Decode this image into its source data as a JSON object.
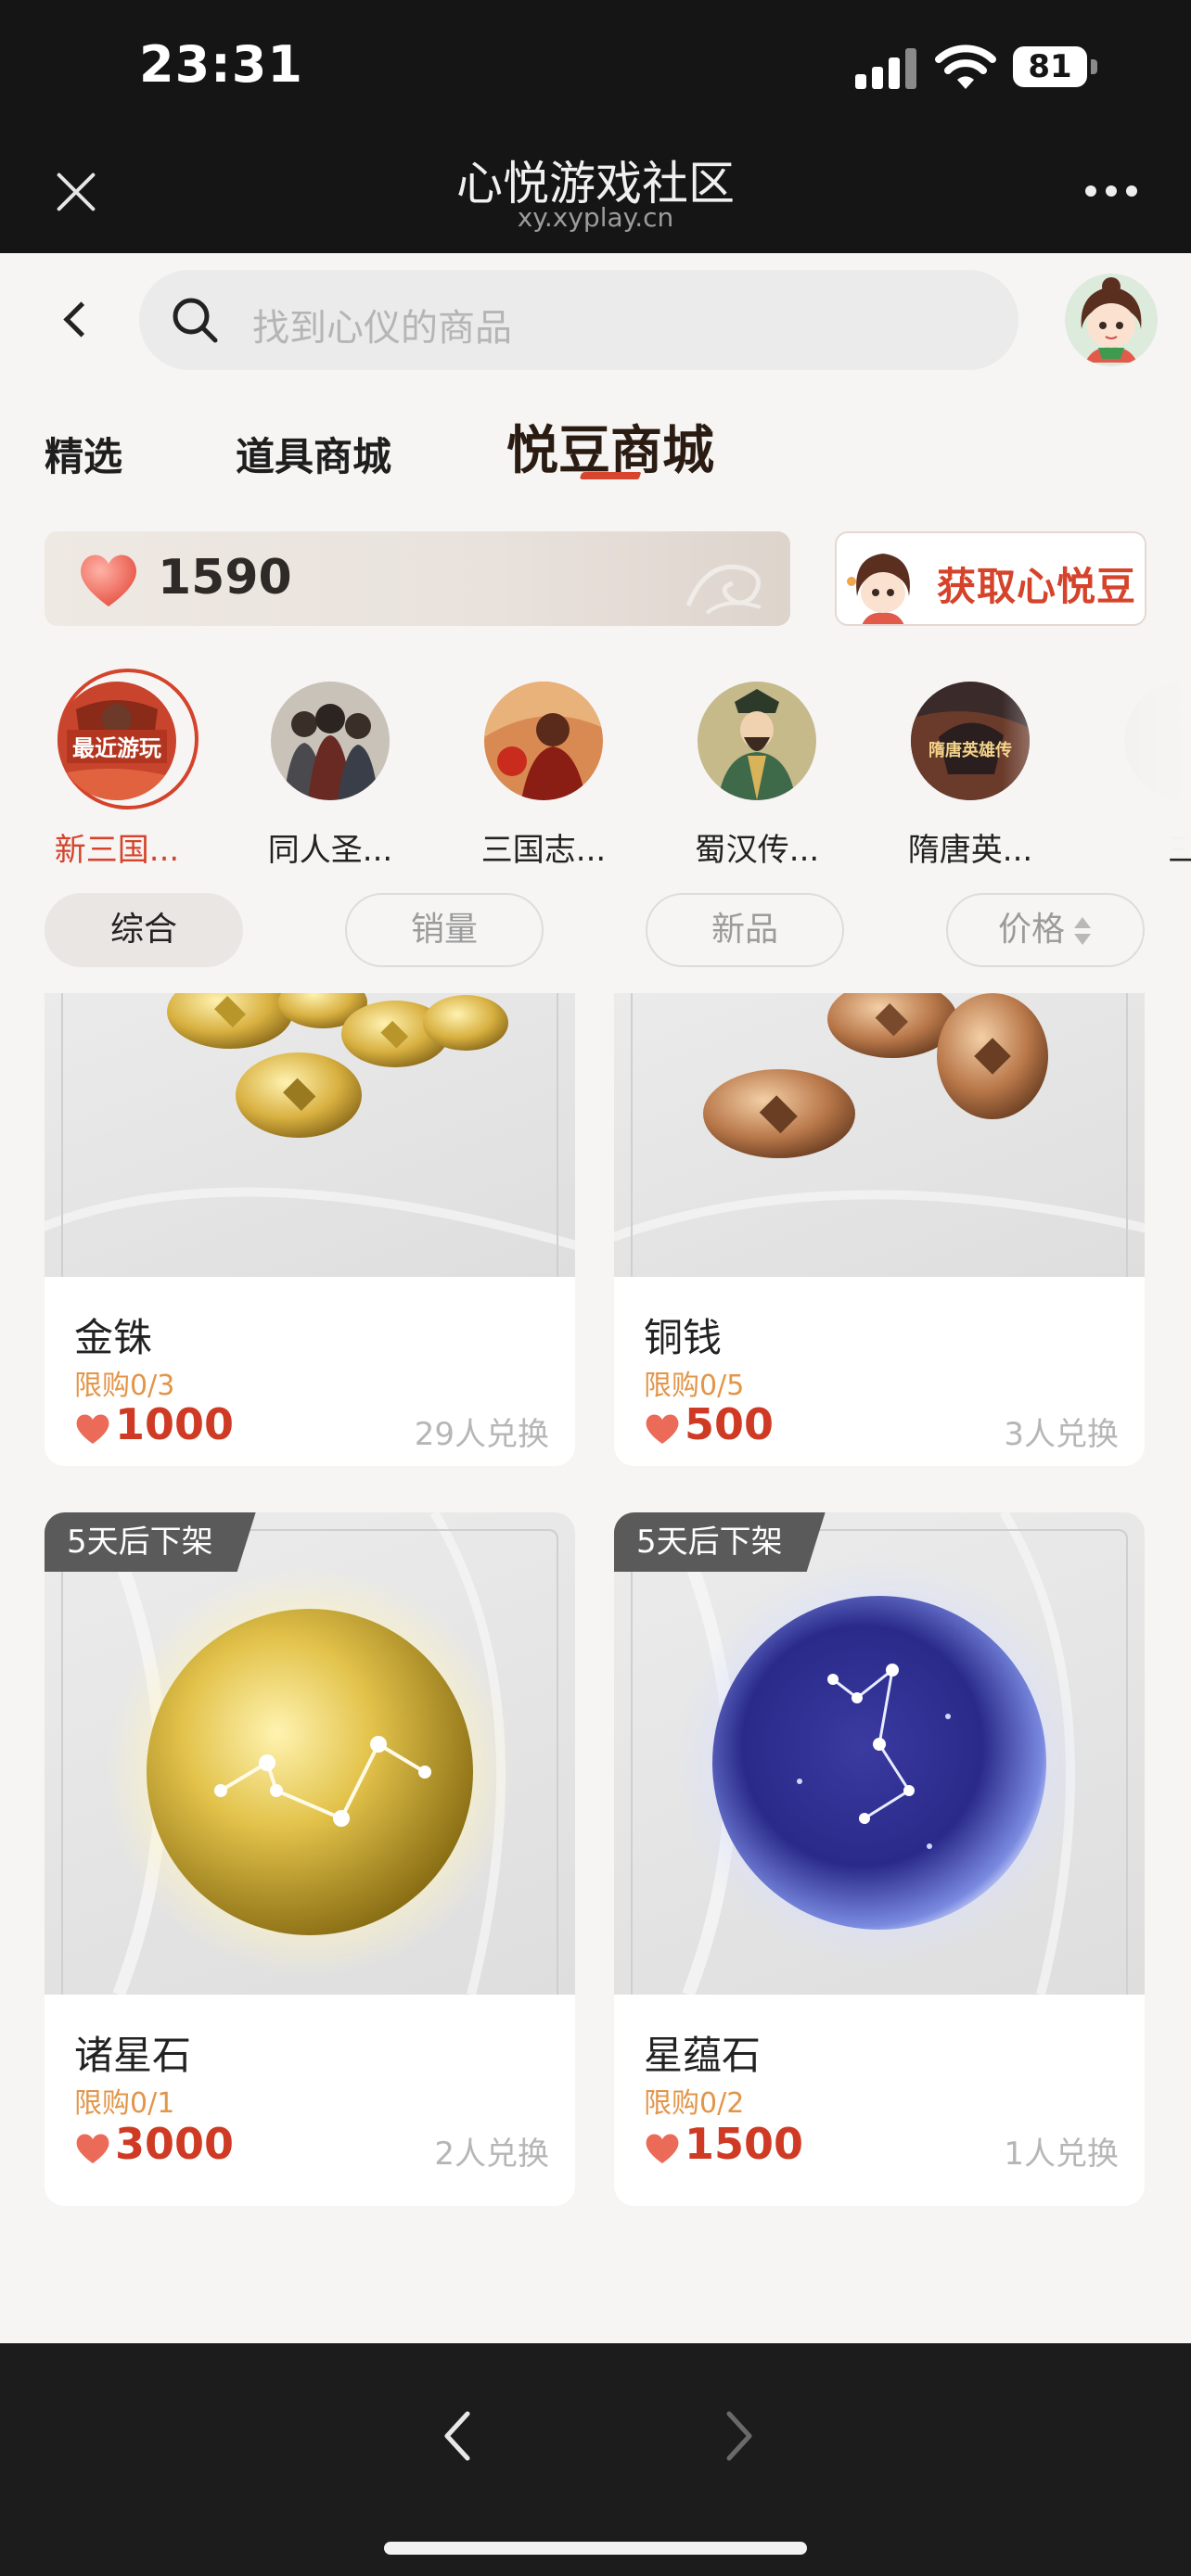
{
  "status_bar": {
    "time": "23:31",
    "battery": "81"
  },
  "navbar": {
    "title": "心悦游戏社区",
    "url": "xy.xyplay.cn"
  },
  "search": {
    "placeholder": "找到心仪的商品"
  },
  "tabs": [
    {
      "label": "精选",
      "active": false
    },
    {
      "label": "道具商城",
      "active": false
    },
    {
      "label": "悦豆商城",
      "active": true
    }
  ],
  "beans": {
    "count": "1590",
    "get_label": "获取心悦豆"
  },
  "games": [
    {
      "label": "新三国...",
      "badge": "最近游玩",
      "active": true
    },
    {
      "label": "同人圣...",
      "active": false
    },
    {
      "label": "三国志...",
      "active": false
    },
    {
      "label": "蜀汉传...",
      "active": false
    },
    {
      "label": "隋唐英...",
      "badge": "隋唐英雄传",
      "active": false
    },
    {
      "label": "三",
      "active": false
    }
  ],
  "sorts": [
    {
      "label": "综合",
      "active": true
    },
    {
      "label": "销量",
      "active": false
    },
    {
      "label": "新品",
      "active": false
    },
    {
      "label": "价格",
      "active": false
    }
  ],
  "products": [
    {
      "name": "金铢",
      "limit": "限购0/3",
      "price": "1000",
      "exchanged": "29人兑换",
      "tag": "",
      "image": "gold-coins"
    },
    {
      "name": "铜钱",
      "limit": "限购0/5",
      "price": "500",
      "exchanged": "3人兑换",
      "tag": "",
      "image": "copper-coins"
    },
    {
      "name": "诸星石",
      "limit": "限购0/1",
      "price": "3000",
      "exchanged": "2人兑换",
      "tag": "5天后下架",
      "image": "gold-star-orb"
    },
    {
      "name": "星蕴石",
      "limit": "限购0/2",
      "price": "1500",
      "exchanged": "1人兑换",
      "tag": "5天后下架",
      "image": "blue-star-orb"
    }
  ],
  "colors": {
    "accent": "#d4432a",
    "price": "#cf3a24",
    "limit": "#e39548",
    "page_bg": "#f6f5f4"
  }
}
